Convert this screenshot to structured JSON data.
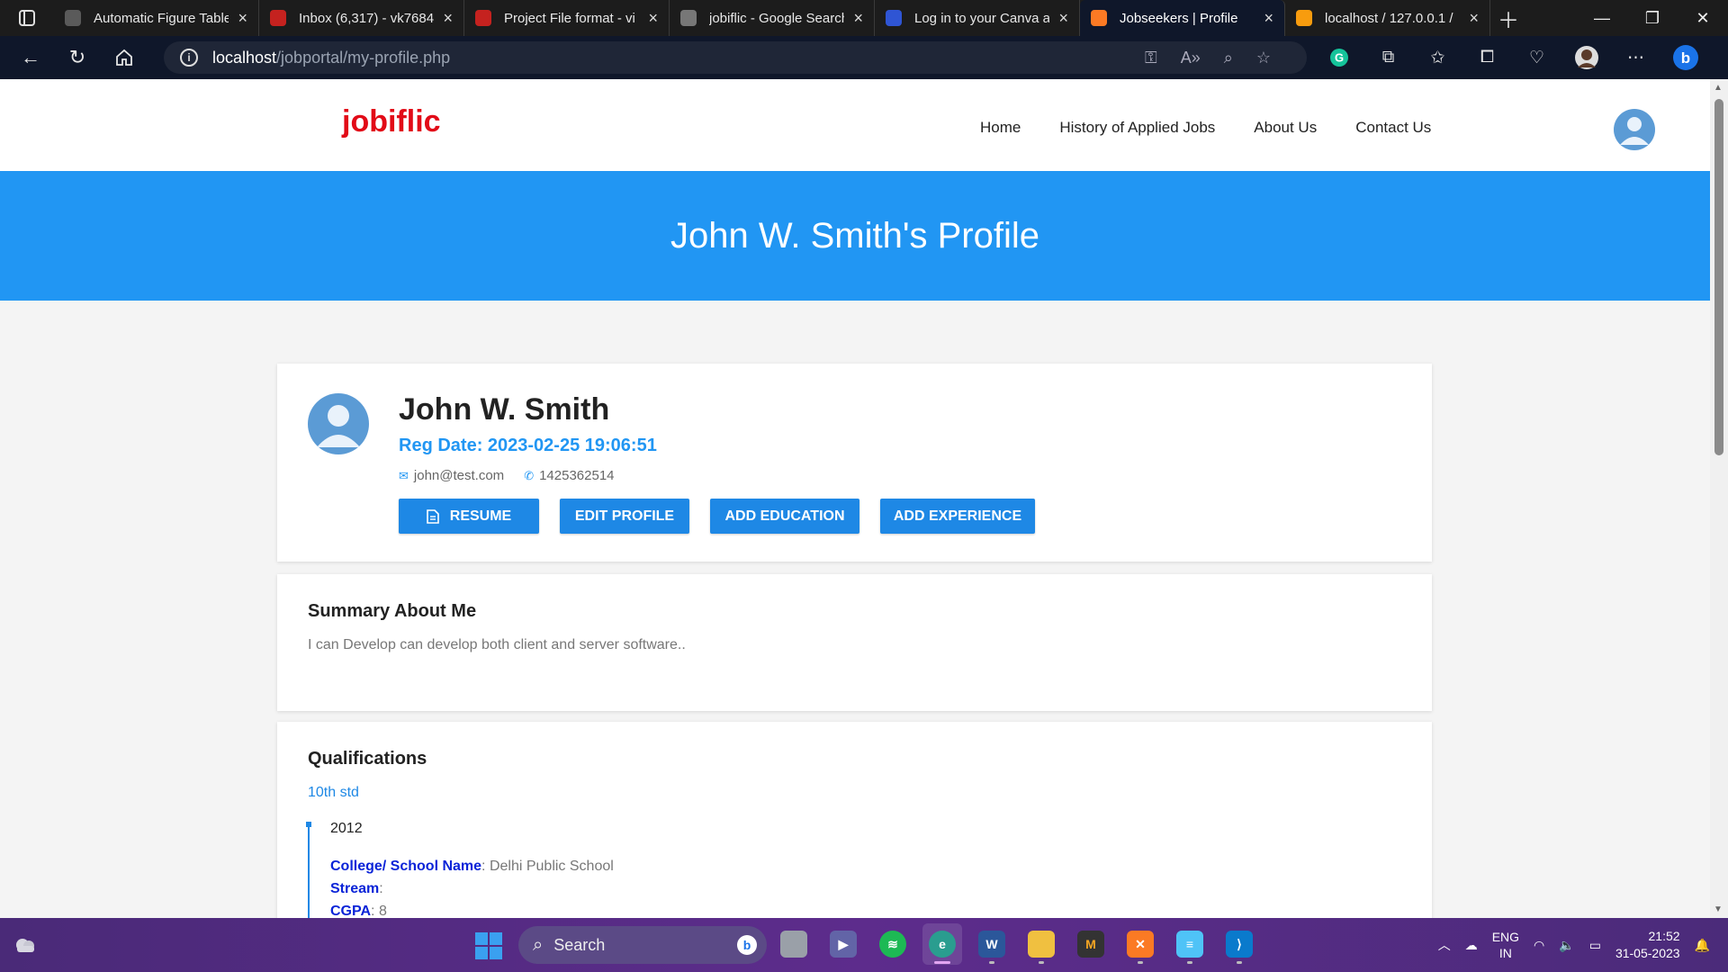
{
  "browser": {
    "tabs": [
      {
        "title": "Automatic Figure Table",
        "favicon": "chatgpt-icon",
        "color": "#5a5a5a"
      },
      {
        "title": "Inbox (6,317) - vk7684",
        "favicon": "gmail-icon",
        "color": "#c5221f"
      },
      {
        "title": "Project File format - vi",
        "favicon": "gmail-icon",
        "color": "#c5221f"
      },
      {
        "title": "jobiflic - Google Search",
        "favicon": "google-icon",
        "color": "#777777"
      },
      {
        "title": "Log in to your Canva a",
        "favicon": "canva-icon",
        "color": "#2f55d4"
      },
      {
        "title": "Jobseekers | Profile",
        "favicon": "xampp-icon",
        "color": "#fb7a24"
      },
      {
        "title": "localhost / 127.0.0.1 /",
        "favicon": "phpmyadmin-icon",
        "color": "#f89c0e"
      }
    ],
    "url_host": "localhost",
    "url_path": "/jobportal/my-profile.php"
  },
  "site": {
    "logo": "jobiflic",
    "nav": [
      "Home",
      "History of Applied Jobs",
      "About Us",
      "Contact Us"
    ],
    "hero_title": "John W. Smith's Profile"
  },
  "profile": {
    "name": "John W. Smith",
    "reg_date": "Reg Date: 2023-02-25 19:06:51",
    "email": "john@test.com",
    "phone": "1425362514",
    "buttons": {
      "resume": "RESUME",
      "edit": "EDIT PROFILE",
      "add_education": "ADD EDUCATION",
      "add_experience": "ADD EXPERIENCE"
    }
  },
  "summary": {
    "heading": "Summary About Me",
    "text": "I can Develop can develop both client and server software.."
  },
  "qualifications": {
    "heading": "Qualifications",
    "level": "10th std",
    "year": "2012",
    "school_label": "College/ School Name",
    "school_value": "Delhi Public School",
    "stream_label": "Stream",
    "stream_value": "",
    "cgpa_label": "CGPA",
    "cgpa_value": "8"
  },
  "taskbar": {
    "search_placeholder": "Search",
    "lang_line1": "ENG",
    "lang_line2": "IN",
    "time": "21:52",
    "date": "31-05-2023"
  }
}
